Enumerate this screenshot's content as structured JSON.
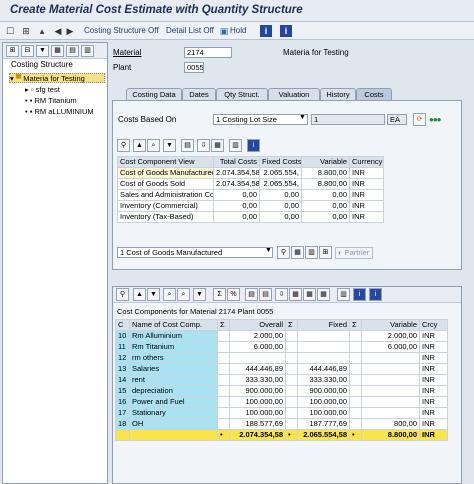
{
  "window": {
    "title": "Create Material Cost Estimate with Quantity Structure"
  },
  "toolbar": {
    "costing_structure_off": "Costing Structure Off",
    "detail_list_off": "Detail List Off",
    "hold": "Hold"
  },
  "tree": {
    "header": "Costing Structure",
    "items": [
      {
        "label": "Materia for Testing"
      },
      {
        "label": "sfg test"
      },
      {
        "label": "RM Titanium"
      },
      {
        "label": "RM aLLUMINIUM"
      }
    ]
  },
  "header_fields": {
    "material_label": "Material",
    "material_value": "2174",
    "material_desc": "Materia for Testing",
    "plant_label": "Plant",
    "plant_value": "0055"
  },
  "tabs": [
    {
      "label": "Costing Data"
    },
    {
      "label": "Dates"
    },
    {
      "label": "Qty Struct."
    },
    {
      "label": "Valuation"
    },
    {
      "label": "History"
    },
    {
      "label": "Costs"
    }
  ],
  "costs_tab": {
    "costs_based_on_label": "Costs Based On",
    "costs_based_on_value": "1 Costing Lot Size",
    "lot_size": "1",
    "unit": "EA",
    "table_headers": [
      "Cost Component View",
      "Total Costs",
      "Fixed Costs",
      "Variable",
      "Currency"
    ],
    "rows": [
      [
        "Cost of Goods Manufactured",
        "2.074.354,58",
        "2.065.554,",
        "8.800,00",
        "INR"
      ],
      [
        "Cost of Goods Sold",
        "2.074.354,58",
        "2.065.554,",
        "8.800,00",
        "INR"
      ],
      [
        "Sales and Administration Costs",
        "0,00",
        "0,00",
        "0,00",
        "INR"
      ],
      [
        "Inventory (Commercial)",
        "0,00",
        "0,00",
        "0,00",
        "INR"
      ],
      [
        "Inventory (Tax-Based)",
        "0,00",
        "0,00",
        "0,00",
        "INR"
      ]
    ],
    "view_select": "1 Cost of Goods Manufactured",
    "partner_label": "Partner"
  },
  "components": {
    "title": "Cost Components for Material 2174 Plant 0055",
    "headers": [
      "C",
      "Name of Cost Comp.",
      "Σ",
      "Overall",
      "Σ",
      "Fixed",
      "Σ",
      "Variable",
      "Crcy"
    ],
    "rows": [
      [
        "10",
        "Rm Alluminium",
        "2.000,00",
        "",
        "2.000,00",
        "INR"
      ],
      [
        "11",
        "Rm Titanium",
        "6.000,00",
        "",
        "6.000,00",
        "INR"
      ],
      [
        "12",
        "rm others",
        "",
        "",
        "",
        "INR"
      ],
      [
        "13",
        "Salaries",
        "444.446,89",
        "444.446,89",
        "",
        "INR"
      ],
      [
        "14",
        "rent",
        "333.330,00",
        "333.330,00",
        "",
        "INR"
      ],
      [
        "15",
        "depreciation",
        "900.000,00",
        "900.000,00",
        "",
        "INR"
      ],
      [
        "16",
        "Power and Fuel",
        "100.000,00",
        "100.000,00",
        "",
        "INR"
      ],
      [
        "17",
        "Stationary",
        "100.000,00",
        "100.000,00",
        "",
        "INR"
      ],
      [
        "18",
        "OH",
        "188.577,69",
        "187.777,69",
        "800,00",
        "INR"
      ]
    ],
    "total": {
      "marker": "•",
      "overall": "2.074.354,58",
      "fixed": "2.065.554,58",
      "variable": "8.800,00",
      "crcy": "INR"
    }
  }
}
